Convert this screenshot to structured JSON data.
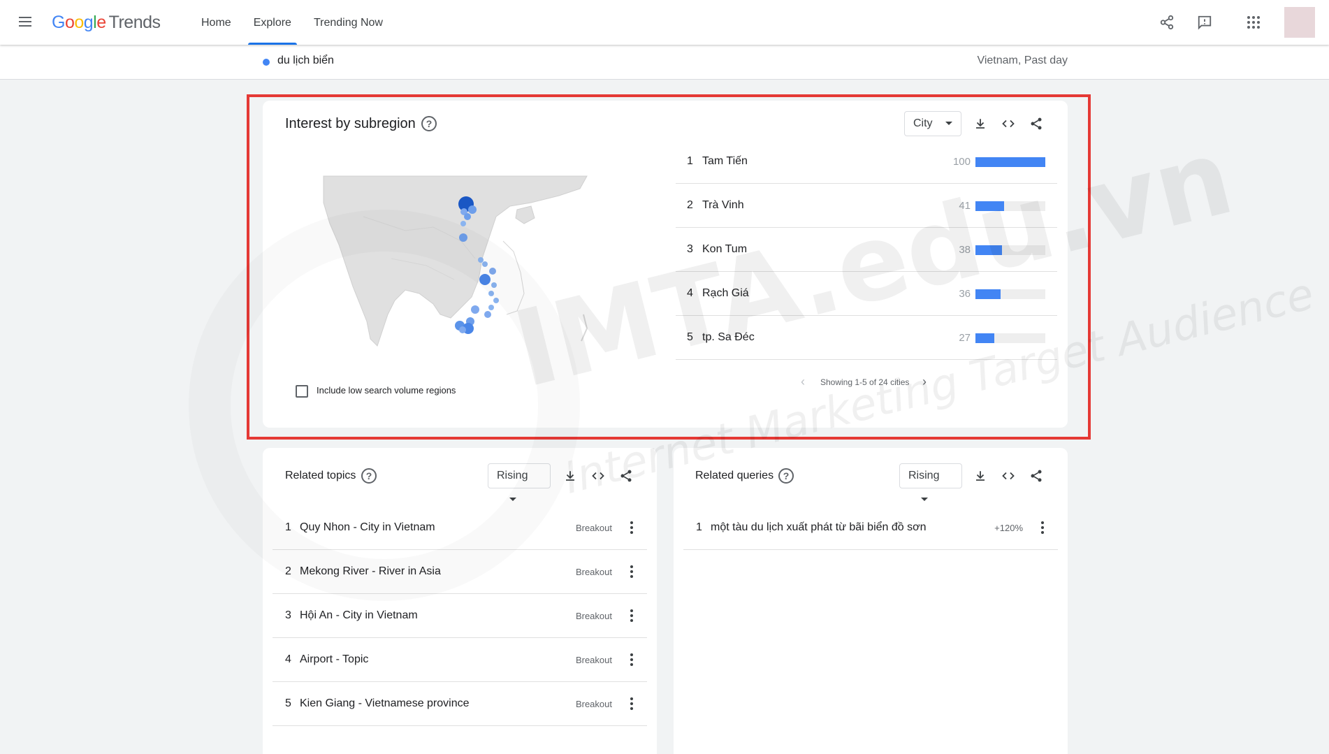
{
  "header": {
    "logo_google": "Google",
    "logo_trends": "Trends",
    "nav": [
      {
        "label": "Home"
      },
      {
        "label": "Explore"
      },
      {
        "label": "Trending Now"
      }
    ]
  },
  "term": {
    "name": "du lịch biển",
    "meta": "Vietnam, Past day",
    "color": "#4285f4"
  },
  "subregion": {
    "title": "Interest by subregion",
    "help": "?",
    "resolution": "City",
    "checkbox_label": "Include low search volume regions",
    "pager": "Showing 1-5 of 24 cities",
    "pager_prev": "‹",
    "pager_next": "›",
    "rows": [
      {
        "rank": "1",
        "name": "Tam Tiến",
        "value": "100",
        "level": 1.0
      },
      {
        "rank": "2",
        "name": "Trà Vinh",
        "value": "41",
        "level": 0.41
      },
      {
        "rank": "3",
        "name": "Kon Tum",
        "value": "38",
        "level": 0.38
      },
      {
        "rank": "4",
        "name": "Rạch Giá",
        "value": "36",
        "level": 0.36
      },
      {
        "rank": "5",
        "name": "tp. Sa Đéc",
        "value": "27",
        "level": 0.27
      }
    ]
  },
  "topics": {
    "title": "Related topics",
    "help": "?",
    "filter": "Rising",
    "rows": [
      {
        "rank": "1",
        "text": "Quy Nhon - City in Vietnam",
        "value": "Breakout"
      },
      {
        "rank": "2",
        "text": "Mekong River - River in Asia",
        "value": "Breakout"
      },
      {
        "rank": "3",
        "text": "Hội An - City in Vietnam",
        "value": "Breakout"
      },
      {
        "rank": "4",
        "text": "Airport - Topic",
        "value": "Breakout"
      },
      {
        "rank": "5",
        "text": "Kien Giang - Vietnamese province",
        "value": "Breakout"
      }
    ]
  },
  "queries": {
    "title": "Related queries",
    "help": "?",
    "filter": "Rising",
    "rows": [
      {
        "rank": "1",
        "text": "một tàu du lịch xuất phát từ bãi biển đồ sơn",
        "value": "+120%"
      }
    ]
  },
  "watermark": {
    "brand": "IMTA.edu.vn",
    "tagline": "Internet Marketing Target Audience"
  },
  "colors": {
    "accent": "#1a73e8",
    "bar": "#4285f4",
    "highlight": "#e53935"
  }
}
